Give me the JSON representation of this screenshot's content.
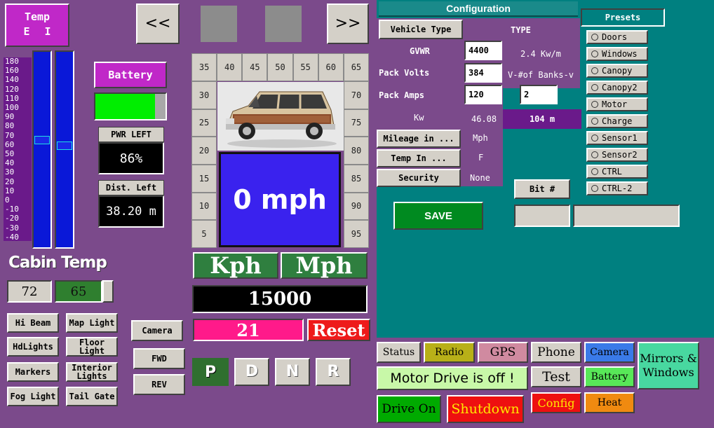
{
  "temp_box": {
    "title": "Temp",
    "e": "E",
    "i": "I"
  },
  "temp_scale": [
    "180",
    "160",
    "140",
    "120",
    "110",
    "100",
    "90",
    "80",
    "70",
    "60",
    "50",
    "40",
    "30",
    "20",
    "10",
    "0",
    "-10",
    "-20",
    "-30",
    "-40"
  ],
  "temp_bars": {
    "left_level": 0.55,
    "right_level": 0.52
  },
  "nav": {
    "back": "<<",
    "forward": ">>"
  },
  "battery": {
    "label": "Battery",
    "level": 0.85,
    "level_color": "#00ee00"
  },
  "pwr_left": {
    "label": "PWR LEFT",
    "value": "86%"
  },
  "dist_left": {
    "label": "Dist. Left",
    "value": "38.20 m"
  },
  "cabin": {
    "label": "Cabin Temp",
    "set": "72",
    "actual": "65"
  },
  "lights": {
    "hi_beam": "Hi Beam",
    "map_light": "Map Light",
    "hdlights": "HdLights",
    "floor_light": "Floor Light",
    "markers": "Markers",
    "interior_lights": "Interior Lights",
    "fog_light": "Fog Light",
    "tail_gate": "Tail Gate"
  },
  "side_buttons": {
    "camera": "Camera",
    "fwd": "FWD",
    "rev": "REV"
  },
  "speed_top": [
    "35",
    "40",
    "45",
    "50",
    "55",
    "60",
    "65"
  ],
  "speed_left": [
    "30",
    "25",
    "20",
    "15",
    "10",
    "5"
  ],
  "speed_right": [
    "70",
    "75",
    "80",
    "85",
    "90",
    "95"
  ],
  "speed": {
    "value": "0 mph",
    "display_color": "#3a22ee"
  },
  "units": {
    "kph": "Kph",
    "mph": "Mph"
  },
  "odometer": "15000",
  "trip": {
    "value": "21",
    "reset": "Reset"
  },
  "gears": {
    "p": "P",
    "d": "D",
    "n": "N",
    "r": "R",
    "active_color": "#2f6f2f"
  },
  "config": {
    "title": "Configuration",
    "vehicle_type_btn": "Vehicle Type",
    "type_label": "TYPE",
    "gvwr_label": "GVWR",
    "gvwr_value": "4400",
    "kw_per_m": "2.4 Kw/m",
    "pack_volts_label": "Pack Volts",
    "pack_volts_value": "384",
    "banks_label": "V-#of Banks-v",
    "banks_value": "2",
    "pack_amps_label": "Pack Amps",
    "pack_amps_value": "120",
    "kw_label": "Kw",
    "kw_value": "46.08",
    "range_value": "104 m",
    "mileage_btn": "Mileage in ...",
    "mileage_unit": "Mph",
    "temp_btn": "Temp In ...",
    "temp_unit": "F",
    "security_btn": "Security",
    "security_value": "None",
    "bit_btn": "Bit #",
    "save": "SAVE",
    "bg_color": "#008080"
  },
  "presets": {
    "title": "Presets",
    "items": [
      "Doors",
      "Windows",
      "Canopy",
      "Canopy2",
      "Motor",
      "Charge",
      "Sensor1",
      "Sensor2",
      "CTRL",
      "CTRL-2"
    ]
  },
  "bottom": {
    "status": "Status",
    "radio": "Radio",
    "gps": "GPS",
    "phone": "Phone",
    "camera": "Camera",
    "mirrors": "Mirrors & Windows",
    "motor_msg": "Motor Drive is off !",
    "test": "Test",
    "battery": "Battery",
    "drive_on": "Drive On",
    "shutdown": "Shutdown",
    "config": "Config",
    "heat": "Heat"
  }
}
